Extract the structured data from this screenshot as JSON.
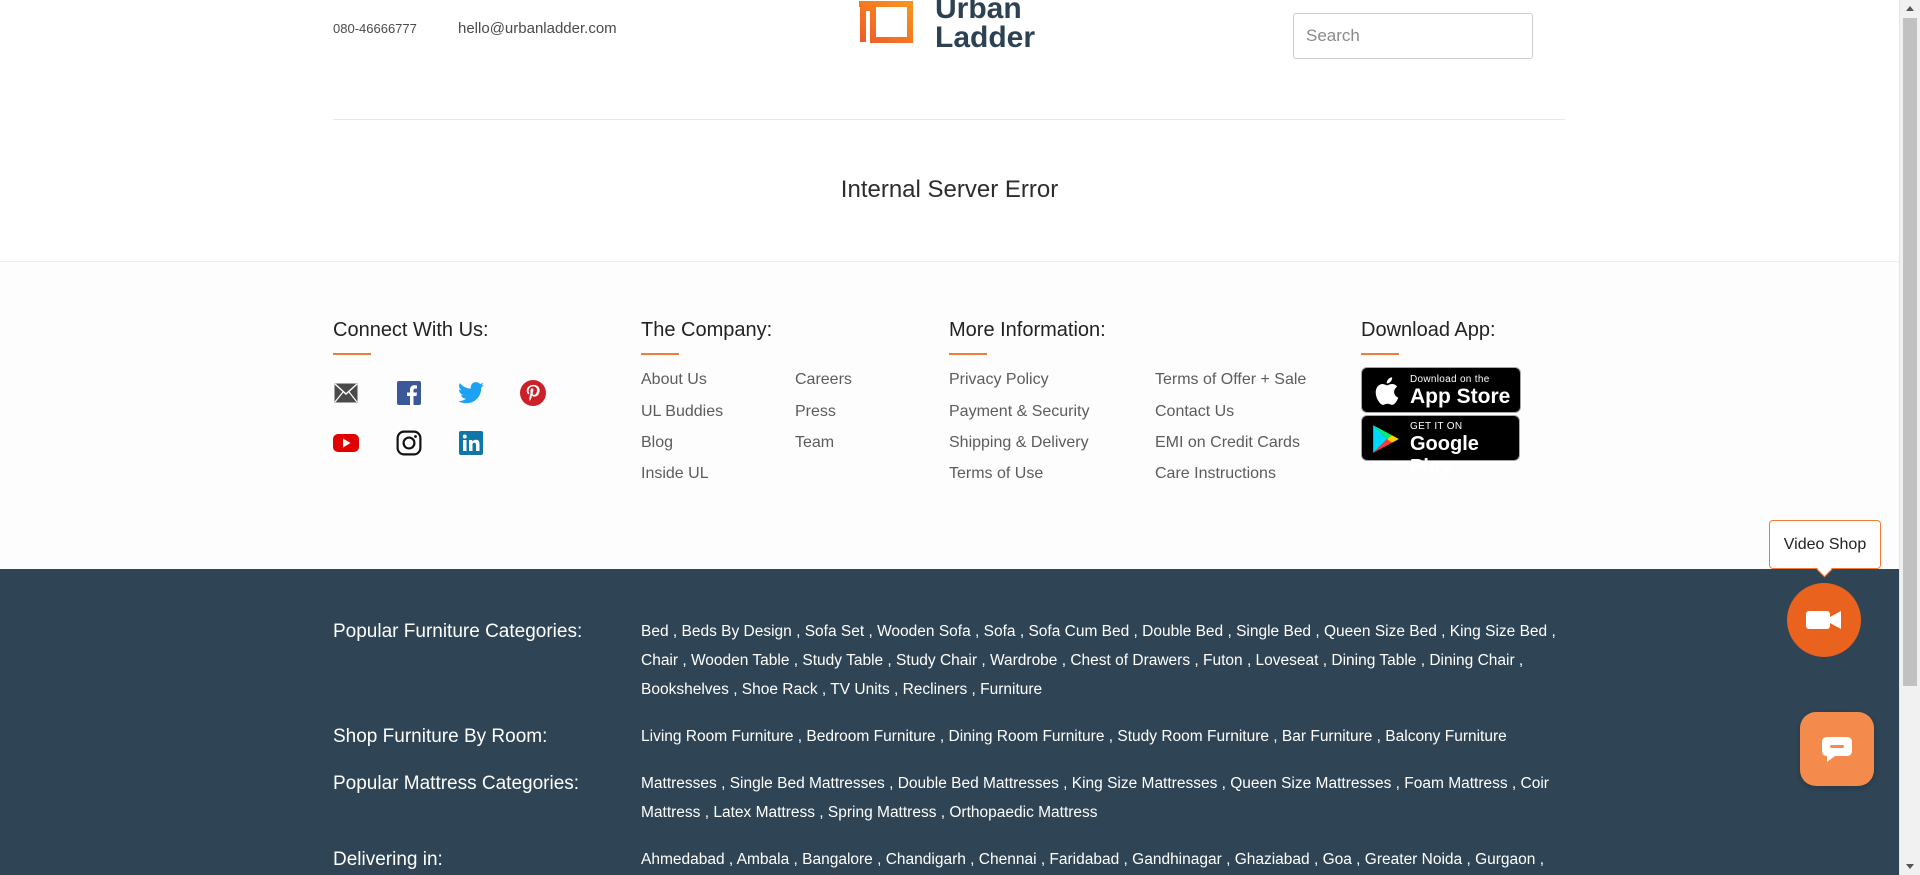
{
  "header": {
    "phone": "080-46666777",
    "email": "hello@urbanladder.com",
    "logo_line1": "Urban",
    "logo_line2": "Ladder",
    "search_placeholder": "Search"
  },
  "main": {
    "error_title": "Internal Server Error"
  },
  "footer": {
    "connect_heading": "Connect With Us:",
    "social_icons": [
      "mail-icon",
      "facebook-icon",
      "twitter-icon",
      "pinterest-icon",
      "youtube-icon",
      "instagram-icon",
      "linkedin-icon"
    ],
    "company_heading": "The Company:",
    "company_links": [
      "About Us",
      "Careers",
      "UL Buddies",
      "Press",
      "Blog",
      "Team",
      "Inside UL"
    ],
    "info_heading": "More Information:",
    "info_links": [
      "Privacy Policy",
      "Terms of Offer + Sale",
      "Payment & Security",
      "Contact Us",
      "Shipping & Delivery",
      "EMI on Credit Cards",
      "Terms of Use",
      "Care Instructions"
    ],
    "app_heading": "Download App:",
    "app_store": {
      "small": "Download on the",
      "big": "App Store"
    },
    "google_play": {
      "small": "GET IT ON",
      "big": "Google Play"
    }
  },
  "seo": {
    "popular_heading": "Popular Furniture Categories:",
    "popular_text": "Bed , Beds By Design , Sofa Set , Wooden Sofa , Sofa , Sofa Cum Bed , Double Bed , Single Bed , Queen Size Bed , King Size Bed , Chair , Wooden Table , Study Table , Study Chair , Wardrobe , Chest of Drawers , Futon , Loveseat , Dining Table , Dining Chair , Bookshelves , Shoe Rack , TV Units , Recliners , Furniture",
    "room_heading": "Shop Furniture By Room:",
    "room_text": "Living Room Furniture , Bedroom Furniture , Dining Room Furniture , Study Room Furniture , Bar Furniture , Balcony Furniture",
    "mattress_heading": "Popular Mattress Categories:",
    "mattress_text": "Mattresses , Single Bed Mattresses , Double Bed Mattresses , King Size Mattresses , Queen Size Mattresses , Foam Mattress , Coir Mattress , Latex Mattress , Spring Mattress , Orthopaedic Mattress",
    "delivering_heading": "Delivering in:",
    "delivering_text": "Ahmedabad , Ambala , Bangalore , Chandigarh , Chennai , Faridabad , Gandhinagar , Ghaziabad , Goa , Greater Noida , Gurgaon ,"
  },
  "floating": {
    "video_shop_label": "Video Shop"
  },
  "colors": {
    "accent": "#f07c3b",
    "dark_footer": "#2f4454",
    "logo_text": "#2c4152"
  }
}
